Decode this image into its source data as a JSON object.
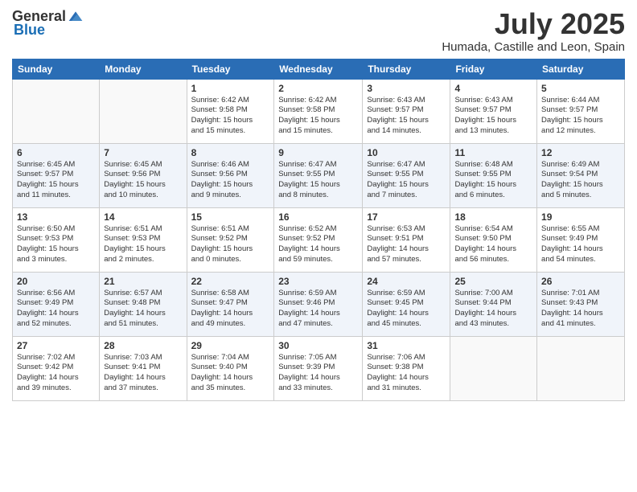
{
  "header": {
    "logo_general": "General",
    "logo_blue": "Blue",
    "main_title": "July 2025",
    "subtitle": "Humada, Castille and Leon, Spain"
  },
  "weekdays": [
    "Sunday",
    "Monday",
    "Tuesday",
    "Wednesday",
    "Thursday",
    "Friday",
    "Saturday"
  ],
  "weeks": [
    [
      {
        "day": "",
        "info": ""
      },
      {
        "day": "",
        "info": ""
      },
      {
        "day": "1",
        "info": "Sunrise: 6:42 AM\nSunset: 9:58 PM\nDaylight: 15 hours\nand 15 minutes."
      },
      {
        "day": "2",
        "info": "Sunrise: 6:42 AM\nSunset: 9:58 PM\nDaylight: 15 hours\nand 15 minutes."
      },
      {
        "day": "3",
        "info": "Sunrise: 6:43 AM\nSunset: 9:57 PM\nDaylight: 15 hours\nand 14 minutes."
      },
      {
        "day": "4",
        "info": "Sunrise: 6:43 AM\nSunset: 9:57 PM\nDaylight: 15 hours\nand 13 minutes."
      },
      {
        "day": "5",
        "info": "Sunrise: 6:44 AM\nSunset: 9:57 PM\nDaylight: 15 hours\nand 12 minutes."
      }
    ],
    [
      {
        "day": "6",
        "info": "Sunrise: 6:45 AM\nSunset: 9:57 PM\nDaylight: 15 hours\nand 11 minutes."
      },
      {
        "day": "7",
        "info": "Sunrise: 6:45 AM\nSunset: 9:56 PM\nDaylight: 15 hours\nand 10 minutes."
      },
      {
        "day": "8",
        "info": "Sunrise: 6:46 AM\nSunset: 9:56 PM\nDaylight: 15 hours\nand 9 minutes."
      },
      {
        "day": "9",
        "info": "Sunrise: 6:47 AM\nSunset: 9:55 PM\nDaylight: 15 hours\nand 8 minutes."
      },
      {
        "day": "10",
        "info": "Sunrise: 6:47 AM\nSunset: 9:55 PM\nDaylight: 15 hours\nand 7 minutes."
      },
      {
        "day": "11",
        "info": "Sunrise: 6:48 AM\nSunset: 9:55 PM\nDaylight: 15 hours\nand 6 minutes."
      },
      {
        "day": "12",
        "info": "Sunrise: 6:49 AM\nSunset: 9:54 PM\nDaylight: 15 hours\nand 5 minutes."
      }
    ],
    [
      {
        "day": "13",
        "info": "Sunrise: 6:50 AM\nSunset: 9:53 PM\nDaylight: 15 hours\nand 3 minutes."
      },
      {
        "day": "14",
        "info": "Sunrise: 6:51 AM\nSunset: 9:53 PM\nDaylight: 15 hours\nand 2 minutes."
      },
      {
        "day": "15",
        "info": "Sunrise: 6:51 AM\nSunset: 9:52 PM\nDaylight: 15 hours\nand 0 minutes."
      },
      {
        "day": "16",
        "info": "Sunrise: 6:52 AM\nSunset: 9:52 PM\nDaylight: 14 hours\nand 59 minutes."
      },
      {
        "day": "17",
        "info": "Sunrise: 6:53 AM\nSunset: 9:51 PM\nDaylight: 14 hours\nand 57 minutes."
      },
      {
        "day": "18",
        "info": "Sunrise: 6:54 AM\nSunset: 9:50 PM\nDaylight: 14 hours\nand 56 minutes."
      },
      {
        "day": "19",
        "info": "Sunrise: 6:55 AM\nSunset: 9:49 PM\nDaylight: 14 hours\nand 54 minutes."
      }
    ],
    [
      {
        "day": "20",
        "info": "Sunrise: 6:56 AM\nSunset: 9:49 PM\nDaylight: 14 hours\nand 52 minutes."
      },
      {
        "day": "21",
        "info": "Sunrise: 6:57 AM\nSunset: 9:48 PM\nDaylight: 14 hours\nand 51 minutes."
      },
      {
        "day": "22",
        "info": "Sunrise: 6:58 AM\nSunset: 9:47 PM\nDaylight: 14 hours\nand 49 minutes."
      },
      {
        "day": "23",
        "info": "Sunrise: 6:59 AM\nSunset: 9:46 PM\nDaylight: 14 hours\nand 47 minutes."
      },
      {
        "day": "24",
        "info": "Sunrise: 6:59 AM\nSunset: 9:45 PM\nDaylight: 14 hours\nand 45 minutes."
      },
      {
        "day": "25",
        "info": "Sunrise: 7:00 AM\nSunset: 9:44 PM\nDaylight: 14 hours\nand 43 minutes."
      },
      {
        "day": "26",
        "info": "Sunrise: 7:01 AM\nSunset: 9:43 PM\nDaylight: 14 hours\nand 41 minutes."
      }
    ],
    [
      {
        "day": "27",
        "info": "Sunrise: 7:02 AM\nSunset: 9:42 PM\nDaylight: 14 hours\nand 39 minutes."
      },
      {
        "day": "28",
        "info": "Sunrise: 7:03 AM\nSunset: 9:41 PM\nDaylight: 14 hours\nand 37 minutes."
      },
      {
        "day": "29",
        "info": "Sunrise: 7:04 AM\nSunset: 9:40 PM\nDaylight: 14 hours\nand 35 minutes."
      },
      {
        "day": "30",
        "info": "Sunrise: 7:05 AM\nSunset: 9:39 PM\nDaylight: 14 hours\nand 33 minutes."
      },
      {
        "day": "31",
        "info": "Sunrise: 7:06 AM\nSunset: 9:38 PM\nDaylight: 14 hours\nand 31 minutes."
      },
      {
        "day": "",
        "info": ""
      },
      {
        "day": "",
        "info": ""
      }
    ]
  ]
}
